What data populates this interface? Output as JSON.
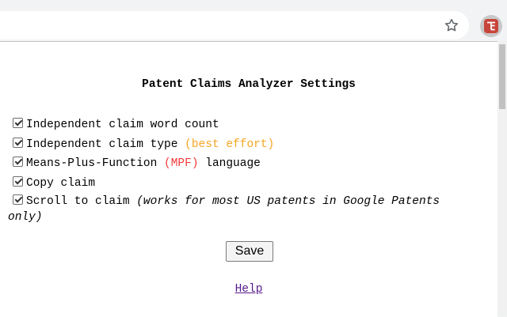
{
  "browser": {
    "bookmark_icon": "star-outline-icon",
    "extension_icon": "patent-claims-analyzer-icon",
    "extension_color": "#c8453b"
  },
  "popup": {
    "title": "Patent Claims Analyzer Settings",
    "options": [
      {
        "label": "Independent claim word count",
        "checked": true
      },
      {
        "label": "Independent claim type",
        "note": "(best effort)",
        "note_color": "#f5a623",
        "checked": true
      },
      {
        "label_before": "Means-Plus-Function",
        "highlight": "(MPF)",
        "highlight_color": "#f03c3c",
        "label_after": "language",
        "checked": true
      },
      {
        "label": "Copy claim",
        "checked": true
      },
      {
        "label": "Scroll to claim",
        "note": "(works for most US patents in Google Patents only)",
        "checked": true
      }
    ],
    "save_label": "Save",
    "help_label": "Help"
  }
}
